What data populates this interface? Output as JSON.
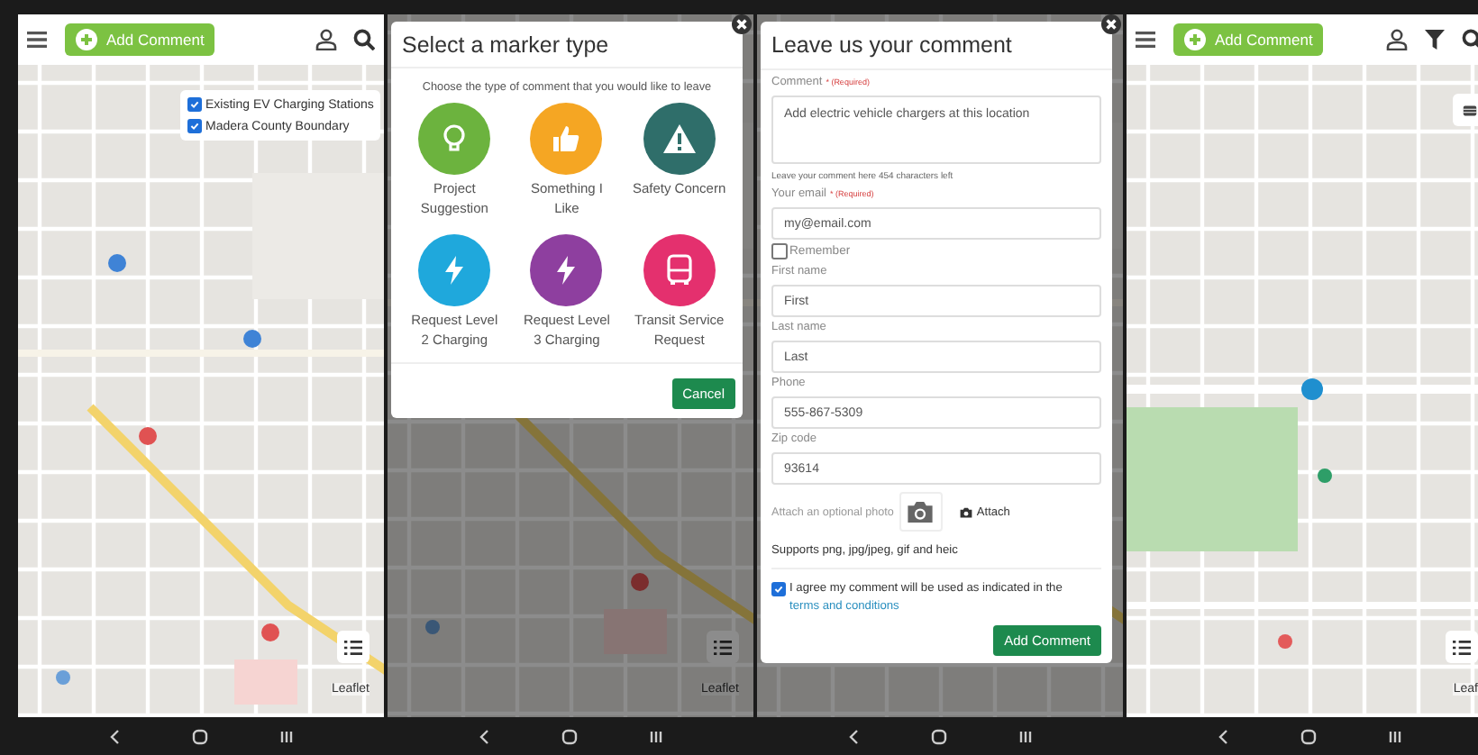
{
  "screens": [
    {
      "kind": "map",
      "header": {
        "button": "Add Comment",
        "tools": [
          {
            "kind": "user"
          },
          {
            "kind": "search"
          }
        ]
      },
      "layers": [
        {
          "label": "Existing EV Charging Stations",
          "checked": true
        },
        {
          "label": "Madera County Boundary",
          "checked": true
        }
      ],
      "attribution": "Leaflet"
    },
    {
      "kind": "marker_dialog",
      "attribution": "Leaflet",
      "dialog": {
        "title": "Select a marker type",
        "prompt": "Choose the type of comment that you would like to leave",
        "options": [
          {
            "label": "Project Suggestion",
            "color": "#6cb33e",
            "kind": "bulb"
          },
          {
            "label": "Something I Like",
            "color": "#f5a623",
            "kind": "thumb"
          },
          {
            "label": "Safety Concern",
            "color": "#2f6e6a",
            "kind": "warning"
          },
          {
            "label": "Request Level 2 Charging",
            "color": "#1fa8dc",
            "kind": "bolt"
          },
          {
            "label": "Request Level 3 Charging",
            "color": "#8e3f9f",
            "kind": "bolt"
          },
          {
            "label": "Transit Service Request",
            "color": "#e4306e",
            "kind": "bus"
          }
        ],
        "cancel": "Cancel"
      }
    },
    {
      "kind": "comment_form",
      "form": {
        "title": "Leave us your comment",
        "fields": [
          {
            "kind": "textarea",
            "label": "Comment",
            "required": "* (Required)",
            "value": "Add electric vehicle chargers at this location",
            "hint": "Leave your comment here 454 characters left"
          },
          {
            "kind": "input",
            "label": "Your email",
            "required": "* (Required)",
            "value": "my@email.com"
          },
          {
            "kind": "checkbox",
            "label": "Remember",
            "checked": false
          },
          {
            "kind": "input",
            "label": "First name",
            "value": "First"
          },
          {
            "kind": "input",
            "label": "Last name",
            "value": "Last"
          },
          {
            "kind": "input",
            "label": "Phone",
            "value": "555-867-5309"
          },
          {
            "kind": "input",
            "label": "Zip code",
            "value": "93614"
          }
        ],
        "attach": {
          "label": "Attach an optional photo",
          "button": "Attach"
        },
        "note": "Supports png, jpg/jpeg, gif and heic",
        "agree": {
          "text": "I agree my comment will be used as indicated in the",
          "link": "terms and conditions",
          "checked": true
        },
        "submit": "Add Comment"
      }
    },
    {
      "kind": "map",
      "header": {
        "button": "Add Comment",
        "tools": [
          {
            "kind": "user"
          },
          {
            "kind": "filter"
          },
          {
            "kind": "search"
          }
        ]
      },
      "attribution": "Leaf",
      "layer_toggle": true
    }
  ]
}
